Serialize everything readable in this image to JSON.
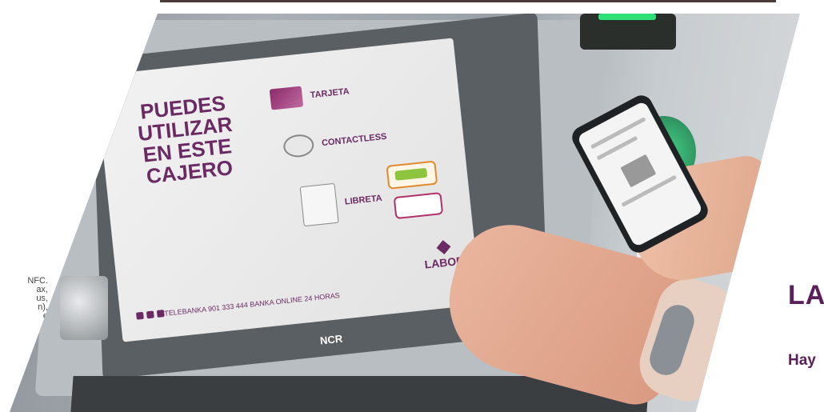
{
  "left_text_fragments": [
    "NFC.",
    "ax,",
    "us,",
    "n),",
    "e"
  ],
  "atm_screen": {
    "headline_lines": [
      "PUEDES",
      "UTILIZAR",
      "EN ESTE",
      "CAJERO"
    ],
    "options": {
      "card_label": "TARJETA",
      "contactless_label": "CONTACTLESS",
      "libreta_label": "LIBRETA"
    },
    "brand": "LABORAL",
    "footer": "TELEBANKA 901 333 444  BANKA ONLINE 24 HORAS"
  },
  "atm_logo": "NCR",
  "page_heading": "LA",
  "page_subheading": "Hay",
  "colors": {
    "brand_purple": "#5b1f5c",
    "atm_green_light": "#2fe07a"
  }
}
